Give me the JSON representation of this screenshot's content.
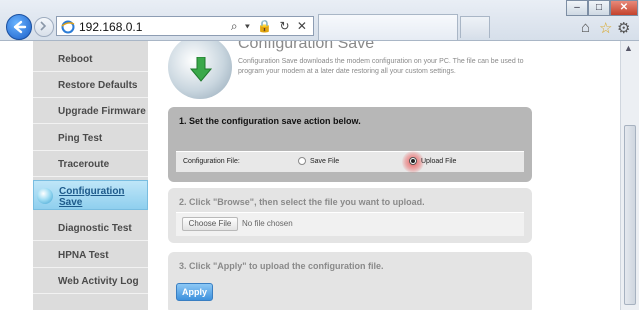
{
  "browser": {
    "url": "192.168.0.1",
    "address_tools": "⌕ ▾ 🔒 ↻ ✕",
    "window_controls": {
      "minimize": "–",
      "maximize": "□",
      "close": "✕"
    },
    "icons": {
      "back": "back-arrow-icon",
      "forward": "forward-arrow-icon",
      "home": "home-icon",
      "favorites": "star-icon",
      "tools": "gear-icon"
    },
    "home_glyph": "⌂",
    "star_glyph": "☆",
    "gear_glyph": "⚙"
  },
  "sidebar": {
    "items": [
      {
        "label": "Reboot"
      },
      {
        "label": "Restore Defaults"
      },
      {
        "label": "Upgrade Firmware"
      },
      {
        "label": "Ping Test"
      },
      {
        "label": "Traceroute"
      },
      {
        "label": "Configuration Save",
        "active": true
      },
      {
        "label": "Diagnostic Test"
      },
      {
        "label": "HPNA Test"
      },
      {
        "label": "Web Activity Log"
      }
    ]
  },
  "header": {
    "title": "Configuration Save",
    "description": "Configuration Save downloads the modem configuration on your PC. The file can be used to program your modem at a later date restoring all your custom settings."
  },
  "step1": {
    "heading": "1. Set the configuration save action below.",
    "field_label": "Configuration File:",
    "option_save": "Save File",
    "option_upload": "Upload File",
    "selected": "Upload File"
  },
  "step2": {
    "heading": "2. Click \"Browse\", then select the file you want to upload.",
    "choose_button": "Choose File",
    "file_status": "No file chosen"
  },
  "step3": {
    "heading": "3. Click \"Apply\" to upload the configuration file.",
    "apply_button": "Apply"
  },
  "colors": {
    "accent": "#3e91dd",
    "active_nav": "#8fcfee",
    "highlight_glow": "#eb4646"
  }
}
